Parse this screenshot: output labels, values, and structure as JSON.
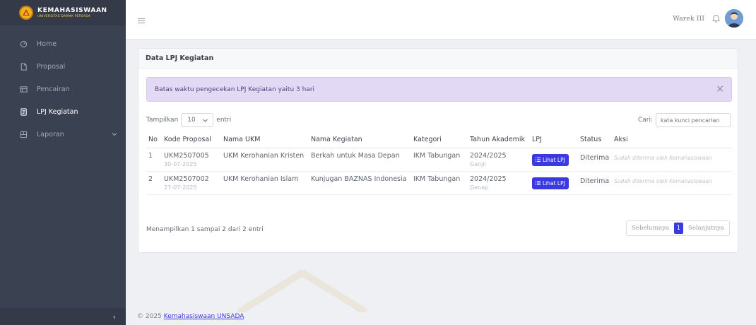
{
  "brand": {
    "title": "KEMAHASISWAAN",
    "subtitle": "UNIVERSITAS DARMA PERSADA"
  },
  "sidebar": {
    "items": [
      {
        "label": "Home",
        "icon": "home-icon"
      },
      {
        "label": "Proposal",
        "icon": "file-icon"
      },
      {
        "label": "Pencairan",
        "icon": "money-icon"
      },
      {
        "label": "LPJ Kegiatan",
        "icon": "clipboard-icon",
        "active": true
      },
      {
        "label": "Laporan",
        "icon": "report-icon",
        "has_caret": true
      }
    ],
    "collapse_label": "‹"
  },
  "topbar": {
    "user_name": "Warek III"
  },
  "card": {
    "title": "Data LPJ Kegiatan",
    "alert": "Batas waktu pengecekan LPJ Kegiatan yaitu 3 hari",
    "alert_close": "×",
    "show_prefix": "Tampilkan",
    "show_value": "10",
    "show_suffix": "entri",
    "search_label": "Cari:",
    "search_placeholder": "kata kunci pencarian",
    "columns": [
      "No",
      "Kode Proposal",
      "Nama UKM",
      "Nama Kegiatan",
      "Kategori",
      "Tahun Akademik",
      "LPJ",
      "Status",
      "Aksi"
    ],
    "rows": [
      {
        "no": "1",
        "kode": "UKM2507005",
        "tanggal": "30-07-2025",
        "ukm": "UKM Kerohanian Kristen",
        "kegiatan": "Berkah untuk Masa Depan",
        "kategori": "IKM Tabungan",
        "tahun": "2024/2025",
        "semester": "Ganjil",
        "lpj_button": "Lihat LPJ",
        "status": "Diterima",
        "aksi": "Sudah diterima oleh Kemahasiswaan"
      },
      {
        "no": "2",
        "kode": "UKM2507002",
        "tanggal": "27-07-2025",
        "ukm": "UKM Kerohanian Islam",
        "kegiatan": "Kunjugan BAZNAS Indonesia",
        "kategori": "IKM Tabungan",
        "tahun": "2024/2025",
        "semester": "Genap",
        "lpj_button": "Lihat LPJ",
        "status": "Diterima",
        "aksi": "Sudah diterima oleh Kemahasiswaan"
      }
    ],
    "info": "Menampilkan 1 sampai 2 dari 2 entri",
    "pager": {
      "prev": "Sebelumnya",
      "current": "1",
      "next": "Selanjutnya"
    }
  },
  "footer": {
    "copyright": "© 2025",
    "link": "Kemahasiswaan UNSADA"
  },
  "colors": {
    "sidebar": "#3a4150",
    "accent": "#3a3ae0",
    "alert_bg": "#e2d9f5"
  }
}
